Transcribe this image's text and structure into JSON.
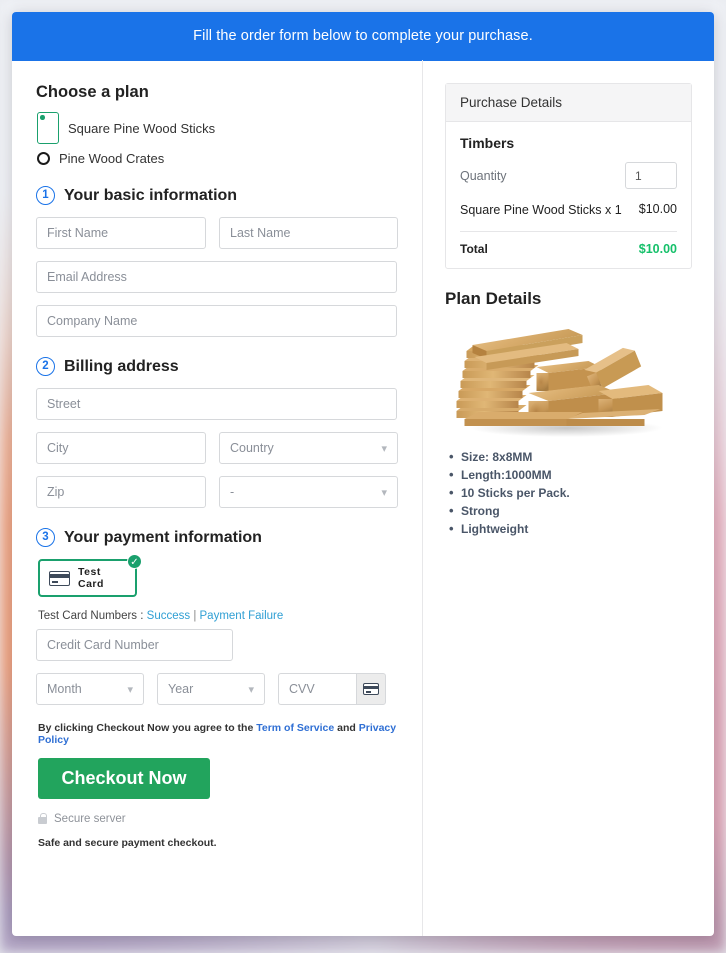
{
  "banner": {
    "text": "Fill the order form below to complete your purchase."
  },
  "plan": {
    "title": "Choose a plan",
    "options": [
      {
        "label": "Square Pine Wood Sticks",
        "selected": true
      },
      {
        "label": "Pine Wood Crates",
        "selected": false
      }
    ],
    "selected_color": "#1aa06d"
  },
  "steps": {
    "basic": {
      "number": "1",
      "label": "Your basic information"
    },
    "billing": {
      "number": "2",
      "label": "Billing address"
    },
    "payment": {
      "number": "3",
      "label": "Your payment information"
    }
  },
  "fields": {
    "first_name": {
      "placeholder": "First Name",
      "value": ""
    },
    "last_name": {
      "placeholder": "Last Name",
      "value": ""
    },
    "email": {
      "placeholder": "Email Address",
      "value": ""
    },
    "company": {
      "placeholder": "Company Name",
      "value": ""
    },
    "street": {
      "placeholder": "Street",
      "value": ""
    },
    "city": {
      "placeholder": "City",
      "value": ""
    },
    "country": {
      "placeholder": "Country",
      "value": ""
    },
    "zip": {
      "placeholder": "Zip",
      "value": ""
    },
    "state": {
      "placeholder": "-",
      "value": ""
    },
    "card_number": {
      "placeholder": "Credit Card Number",
      "value": ""
    },
    "month": {
      "placeholder": "Month",
      "value": ""
    },
    "year": {
      "placeholder": "Year",
      "value": ""
    },
    "cvv": {
      "placeholder": "CVV",
      "value": ""
    }
  },
  "payment": {
    "chip_label": "Test Card",
    "chip_check": "✓",
    "test_numbers_prefix": "Test Card Numbers : ",
    "link_success": "Success",
    "link_separator": " | ",
    "link_failure": "Payment Failure",
    "terms_prefix": "By clicking Checkout Now you agree to the ",
    "terms_link": "Term of Service",
    "terms_mid": " and ",
    "privacy_link": "Privacy Policy",
    "checkout_label": "Checkout Now",
    "secure_label": "Secure server",
    "safe_note": "Safe and secure payment checkout.",
    "button_color": "#22a45d"
  },
  "summary": {
    "panel_header": "Purchase Details",
    "product_group": "Timbers",
    "quantity_label": "Quantity",
    "quantity_value": "1",
    "line_item_name": "Square Pine Wood Sticks x 1",
    "line_item_price": "$10.00",
    "total_label": "Total",
    "total_value": "$10.00",
    "total_color": "#15c06a"
  },
  "plan_details": {
    "title": "Plan Details",
    "image_alt": "stack-of-timber-planks",
    "bullets": [
      "Size: 8x8MM",
      "Length:1000MM",
      "10 Sticks per Pack.",
      "Strong",
      "Lightweight"
    ]
  }
}
